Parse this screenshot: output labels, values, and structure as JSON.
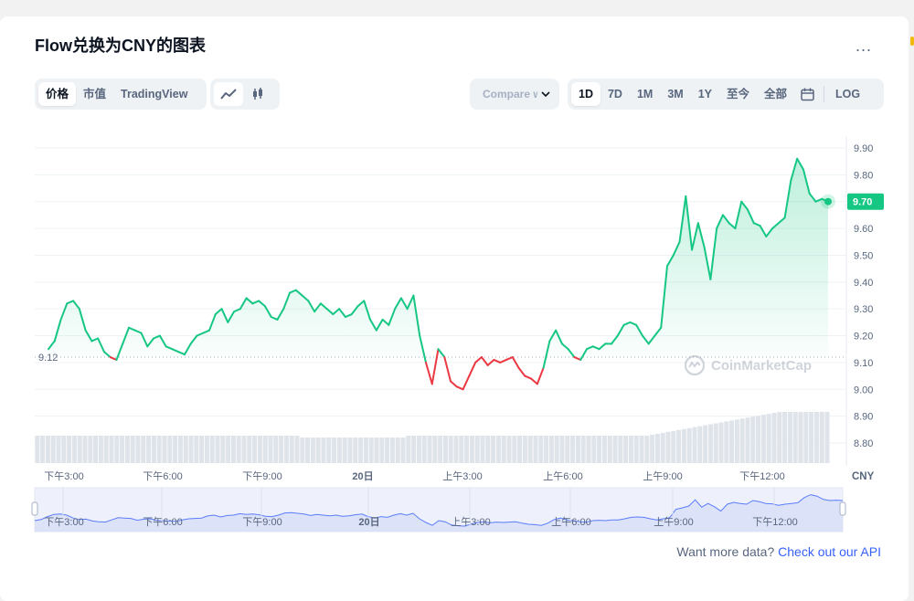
{
  "title": "Flow兑换为CNY的图表",
  "more_label": "...",
  "tabs": [
    "价格",
    "市值",
    "TradingView"
  ],
  "compare_label": "Compare with",
  "ranges": [
    "1D",
    "7D",
    "1M",
    "3M",
    "1Y",
    "至今",
    "全部"
  ],
  "log_label": "LOG",
  "watermark": "CoinMarketCap",
  "footer": {
    "text": "Want more data?",
    "link": "Check out our API"
  },
  "chart_data": {
    "type": "line",
    "currency": "CNY",
    "y_ticks": [
      "9.90",
      "9.80",
      "9.70",
      "9.60",
      "9.50",
      "9.40",
      "9.30",
      "9.20",
      "9.10",
      "9.00",
      "8.90",
      "8.80"
    ],
    "ylim": [
      8.8,
      9.9
    ],
    "x_ticks": [
      "下午3:00",
      "下午6:00",
      "下午9:00",
      "20日",
      "上午3:00",
      "上午6:00",
      "上午9:00",
      "下午12:00"
    ],
    "baseline_label": "9.12",
    "baseline": 9.12,
    "current_label": "9.70",
    "current": 9.7,
    "up_color": "#16c784",
    "down_color": "#ea3943",
    "grid": true,
    "prices": [
      9.15,
      9.18,
      9.26,
      9.32,
      9.33,
      9.3,
      9.22,
      9.18,
      9.19,
      9.14,
      9.12,
      9.11,
      9.17,
      9.23,
      9.22,
      9.21,
      9.16,
      9.19,
      9.2,
      9.16,
      9.15,
      9.14,
      9.13,
      9.17,
      9.2,
      9.21,
      9.22,
      9.28,
      9.3,
      9.25,
      9.29,
      9.3,
      9.34,
      9.32,
      9.33,
      9.31,
      9.27,
      9.26,
      9.3,
      9.36,
      9.37,
      9.35,
      9.33,
      9.29,
      9.32,
      9.3,
      9.28,
      9.3,
      9.27,
      9.28,
      9.31,
      9.33,
      9.26,
      9.22,
      9.26,
      9.24,
      9.3,
      9.34,
      9.3,
      9.35,
      9.2,
      9.1,
      9.02,
      9.15,
      9.12,
      9.03,
      9.01,
      9.0,
      9.05,
      9.1,
      9.12,
      9.09,
      9.11,
      9.1,
      9.11,
      9.12,
      9.08,
      9.05,
      9.04,
      9.02,
      9.08,
      9.18,
      9.22,
      9.17,
      9.15,
      9.12,
      9.11,
      9.15,
      9.16,
      9.15,
      9.17,
      9.17,
      9.2,
      9.24,
      9.25,
      9.24,
      9.2,
      9.17,
      9.2,
      9.23,
      9.46,
      9.5,
      9.55,
      9.72,
      9.52,
      9.62,
      9.53,
      9.41,
      9.6,
      9.65,
      9.62,
      9.6,
      9.7,
      9.67,
      9.62,
      9.61,
      9.57,
      9.6,
      9.62,
      9.64,
      9.78,
      9.86,
      9.82,
      9.73,
      9.7,
      9.71,
      9.7
    ]
  }
}
